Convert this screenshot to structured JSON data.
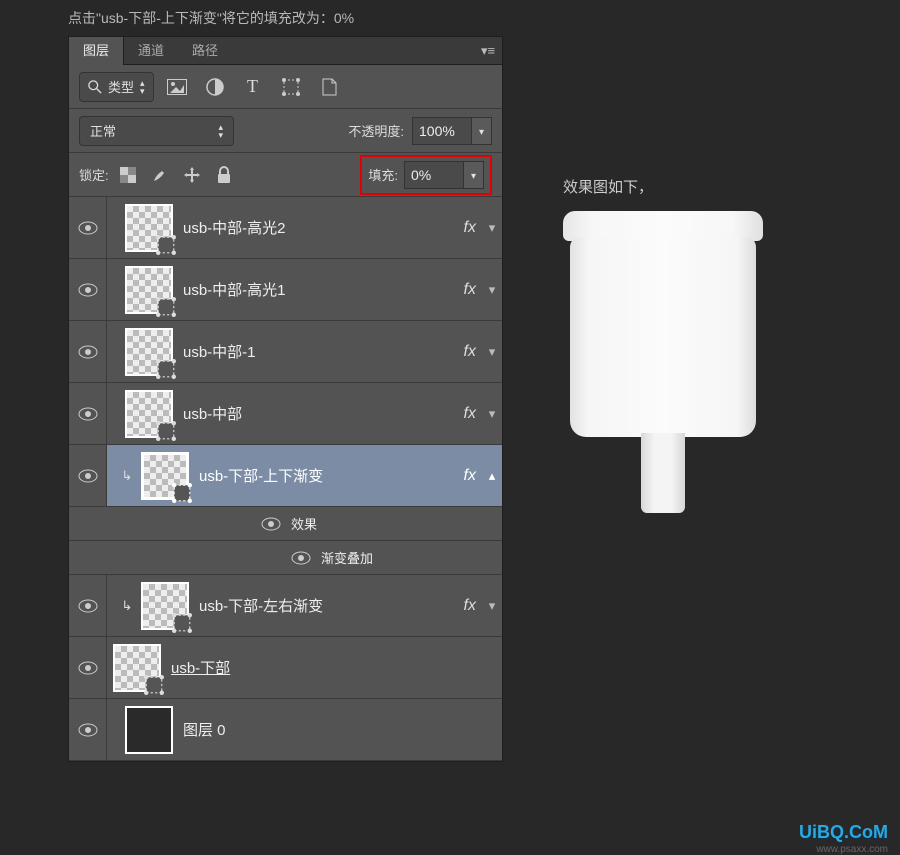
{
  "instruction": "点击\"usb-下部-上下渐变\"将它的填充改为：0%",
  "tabs": {
    "layers": "图层",
    "channels": "通道",
    "paths": "路径"
  },
  "filter": {
    "type_label": "类型"
  },
  "blend": {
    "mode": "正常",
    "opacity_label": "不透明度:",
    "opacity_value": "100%"
  },
  "lock": {
    "label": "锁定:",
    "fill_label": "填充:",
    "fill_value": "0%"
  },
  "layers": [
    {
      "name": "usb-中部-高光2",
      "fx": "fx"
    },
    {
      "name": "usb-中部-高光1",
      "fx": "fx"
    },
    {
      "name": "usb-中部-1",
      "fx": "fx"
    },
    {
      "name": "usb-中部",
      "fx": "fx"
    },
    {
      "name": "usb-下部-上下渐变",
      "fx": "fx"
    },
    {
      "name": "usb-下部-左右渐变",
      "fx": "fx"
    },
    {
      "name": "usb-下部"
    },
    {
      "name": "图层 0"
    }
  ],
  "effects": {
    "title": "效果",
    "gradient_overlay": "渐变叠加"
  },
  "preview": {
    "caption": "效果图如下，"
  },
  "watermark": {
    "main": "UiBQ.CoM",
    "sub": "www.psaxx.com"
  }
}
